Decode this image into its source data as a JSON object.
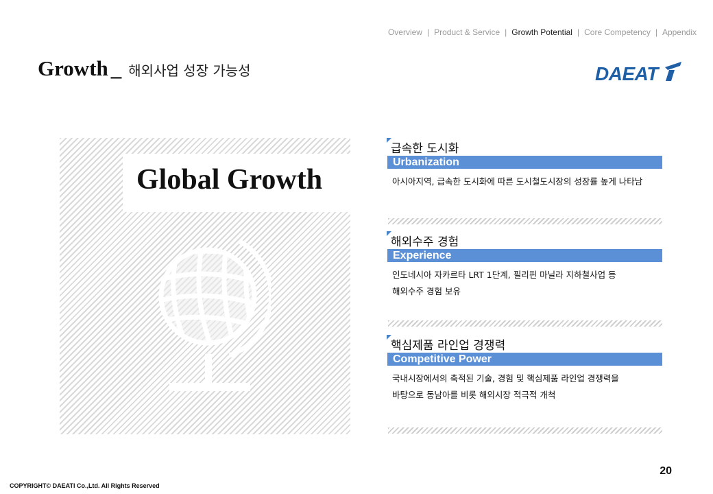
{
  "nav": {
    "items": [
      {
        "label": "Overview",
        "active": false
      },
      {
        "label": "Product & Service",
        "active": false
      },
      {
        "label": "Growth Potential",
        "active": true
      },
      {
        "label": "Core Competency",
        "active": false
      },
      {
        "label": "Appendix",
        "active": false
      }
    ],
    "separator": "|"
  },
  "header": {
    "title_en": "Growth",
    "title_sep": "_",
    "title_ko": "해외사업 성장 가능성"
  },
  "logo": {
    "text": "DAEATi",
    "color": "#1f5fa6",
    "icon": "daeati-logo"
  },
  "hero": {
    "text": "Global Growth",
    "icon": "globe-icon"
  },
  "sections": [
    {
      "title": "급속한 도시화",
      "bar": "Urbanization",
      "lines": [
        "아시아지역, 급속한 도시화에 따른 도시철도시장의 성장률 높게 나타남"
      ]
    },
    {
      "title": "해외수주 경험",
      "bar": "Experience",
      "lines": [
        "인도네시아 자카르타 LRT 1단계, 필리핀 마닐라 지하철사업 등",
        "해외수주 경험 보유"
      ]
    },
    {
      "title": "핵심제품 라인업 경쟁력",
      "bar": "Competitive Power",
      "lines": [
        "국내시장에서의 축적된 기술, 경험 및 핵심제품 라인업 경쟁력을",
        "바탕으로 동남아를 비롯 해외시장 적극적 개척"
      ]
    }
  ],
  "colors": {
    "accent_bar": "#5b8fd6",
    "marker": "#4a82c8",
    "hatch": "#d9d9d9"
  },
  "footer": {
    "page_number": "20",
    "copyright": "COPYRIGHT© DAEATI Co.,Ltd. All Rights Reserved"
  }
}
